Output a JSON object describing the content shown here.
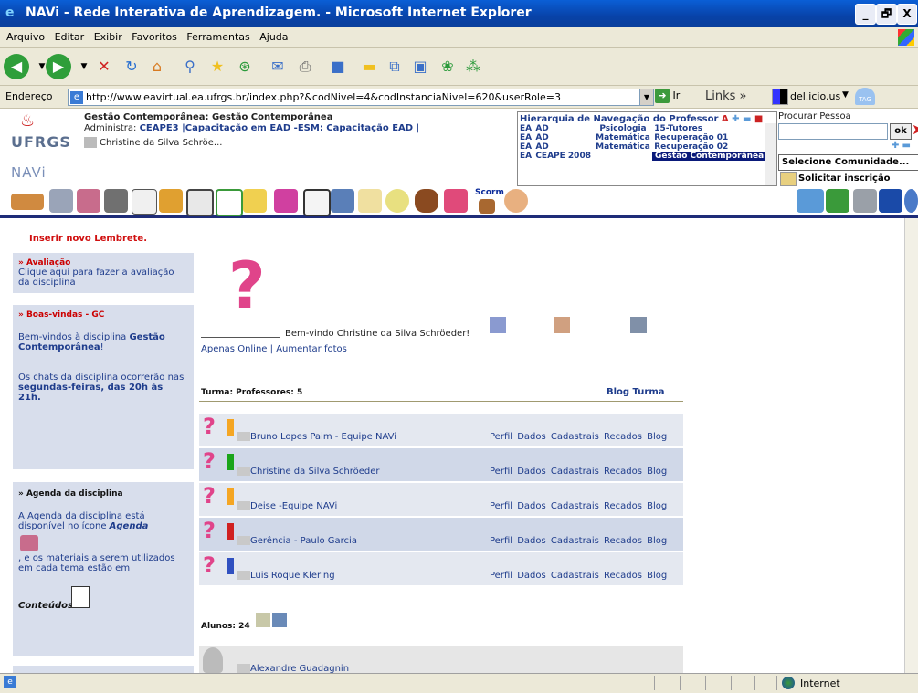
{
  "window": {
    "title": "NAVi - Rede Interativa de Aprendizagem. - Microsoft Internet Explorer",
    "minimize": "_",
    "maximize": "🗗",
    "close": "X"
  },
  "menu": [
    "Arquivo",
    "Editar",
    "Exibir",
    "Favoritos",
    "Ferramentas",
    "Ajuda"
  ],
  "address": {
    "label": "Endereço",
    "url": "http://www.eavirtual.ea.ufrgs.br/index.php?&codNivel=4&codInstanciaNivel=620&userRole=3",
    "go_label": "Ir",
    "links_label": "Links",
    "delicious": "del.icio.us",
    "tag": "TAG"
  },
  "header": {
    "logo_text": "UFRGS",
    "navi_text": "NAVi",
    "course_title": "Gestão Contemporânea: Gestão Contemporânea",
    "admin_prefix": "Administra:",
    "admin_value": "CEAPE3 |Capacitação em EAD -ESM: Capacitação EAD |",
    "user": "Christine da Silva Schröe..."
  },
  "hierarchy": {
    "title": "Hierarquia de Navegação do Professor",
    "ctrl_a": "A",
    "rows": [
      {
        "c1": "EA",
        "c2": "AD",
        "c3": "Psicologia",
        "c4": "15-Tutores",
        "sel": false
      },
      {
        "c1": "EA",
        "c2": "AD",
        "c3": "Matemática",
        "c4": "Recuperação 01",
        "sel": false
      },
      {
        "c1": "EA",
        "c2": "AD",
        "c3": "Matemática",
        "c4": "Recuperação 02",
        "sel": false
      },
      {
        "c1": "EA",
        "c2": "CEAPE 2008",
        "c3": "",
        "c4": "Gestão Contemporânea",
        "sel": true
      }
    ]
  },
  "search": {
    "label": "Procurar Pessoa",
    "ok": "ok",
    "community": "Selecione Comunidade...",
    "request": "Solicitar inscrição"
  },
  "sidebar": {
    "insert_reminder": "Inserir novo Lembrete.",
    "avaliacao_title": "» Avaliação",
    "avaliacao_text": "Clique aqui para fazer a avaliação da disciplina",
    "boas_title": "» Boas-vindas - GC",
    "boas_text1": "Bem-vindos à disciplina ",
    "boas_bold": "Gestão Contemporânea",
    "boas_text1_end": "!",
    "boas_text2": "Os chats da disciplina ocorrerão nas ",
    "boas_bold2": "segundas-feiras, das 20h às 21h.",
    "agenda_title": "» Agenda da disciplina",
    "agenda_text1": "A Agenda da disciplina está disponível no ícone ",
    "agenda_bold": "Agenda",
    "agenda_text2": ", e os materiais a serem utilizados em cada tema estão em",
    "conteudos": "Conteúdos"
  },
  "center": {
    "welcome": "Bem-vindo Christine da Silva Schröeder!",
    "online_only": "Apenas Online",
    "sep": "|",
    "enlarge": "Aumentar fotos",
    "turma_label": "Turma: Professores: 5",
    "blog_turma": "Blog Turma",
    "professors": [
      {
        "name": "Bruno Lopes Paim - Equipe NAVi",
        "color": "#f5a623"
      },
      {
        "name": "Christine da Silva Schröeder",
        "color": "#1aa51a"
      },
      {
        "name": "Deise -Equipe NAVi",
        "color": "#f5a623"
      },
      {
        "name": "Gerência - Paulo Garcia",
        "color": "#d02020"
      },
      {
        "name": "Luis Roque Klering",
        "color": "#3050c0"
      }
    ],
    "links": {
      "perfil": "Perfil",
      "dados": "Dados Cadastrais",
      "recados": "Recados",
      "blog": "Blog"
    },
    "alunos_label": "Alunos: 24",
    "student_partial": "Alexandre Guadagnin"
  },
  "status": {
    "zone": "Internet"
  }
}
